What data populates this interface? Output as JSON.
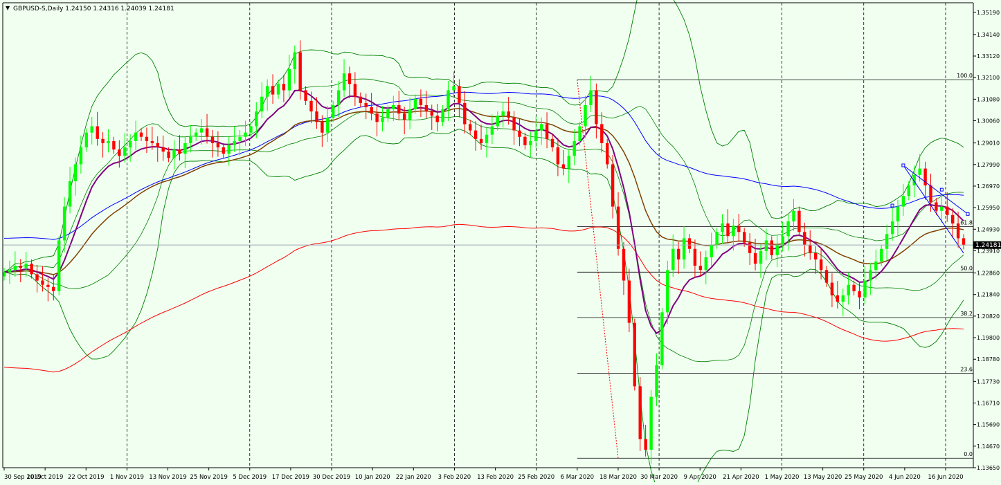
{
  "header": {
    "text": "GBPUSD-S,Daily  1.24150 1.24316 1.24039 1.24181",
    "menu_glyph": "▼"
  },
  "colors": {
    "background": "#f0fff0",
    "bull_candle": "#00ff00",
    "bear_candle": "#ff0000",
    "ma_purple": "#800080",
    "ma_brown": "#804000",
    "ma_blue": "#0000ff",
    "ma_red": "#ff0000",
    "bollinger": "#008000",
    "fib_level": "#000000",
    "trendline": "#0000ff"
  },
  "chart_data": {
    "type": "candlestick",
    "symbol": "GBPUSD-S",
    "timeframe": "Daily",
    "last_quote": {
      "open": 1.2415,
      "high": 1.24316,
      "low": 1.24039,
      "close": 1.24181
    },
    "current_price_label": "1.24181",
    "current_price": 1.24181,
    "ylim": [
      1.1365,
      1.3564
    ],
    "y_ticks": [
      "1.35190",
      "1.34140",
      "1.33120",
      "1.32100",
      "1.31080",
      "1.30060",
      "1.29010",
      "1.27990",
      "1.26970",
      "1.25950",
      "1.24930",
      "1.23910",
      "1.22860",
      "1.21840",
      "1.20820",
      "1.19800",
      "1.18780",
      "1.17730",
      "1.16710",
      "1.15690",
      "1.14670",
      "1.13650"
    ],
    "x_labels": [
      "30 Sep 2019",
      "10 Oct 2019",
      "22 Oct 2019",
      "1 Nov 2019",
      "13 Nov 2019",
      "25 Nov 2019",
      "5 Dec 2019",
      "17 Dec 2019",
      "30 Dec 2019",
      "10 Jan 2020",
      "22 Jan 2020",
      "3 Feb 2020",
      "13 Feb 2020",
      "25 Feb 2020",
      "6 Mar 2020",
      "18 Mar 2020",
      "30 Mar 2020",
      "9 Apr 2020",
      "21 Apr 2020",
      "1 May 2020",
      "13 May 2020",
      "25 May 2020",
      "4 Jun 2020",
      "16 Jun 2020"
    ],
    "period_separators": [
      "1 Nov 2019",
      "5 Dec 2019",
      "30 Dec 2019",
      "3 Feb 2020",
      "25 Feb 2020",
      "30 Mar 2020",
      "1 May 2020",
      "25 May 2020",
      "16 Jun 2020"
    ],
    "fibonacci": [
      {
        "label": "100.0",
        "price": 1.32
      },
      {
        "label": "61.8",
        "price": 1.2505
      },
      {
        "label": "50.0",
        "price": 1.229
      },
      {
        "label": "38.2",
        "price": 1.2075
      },
      {
        "label": "23.6",
        "price": 1.1812
      },
      {
        "label": "0.0",
        "price": 1.141
      }
    ],
    "closes": [
      1.229,
      1.23,
      1.232,
      1.231,
      1.233,
      1.228,
      1.225,
      1.223,
      1.222,
      1.22,
      1.244,
      1.26,
      1.272,
      1.28,
      1.288,
      1.295,
      1.298,
      1.292,
      1.29,
      1.291,
      1.287,
      1.284,
      1.288,
      1.291,
      1.295,
      1.293,
      1.291,
      1.29,
      1.288,
      1.286,
      1.283,
      1.287,
      1.285,
      1.29,
      1.293,
      1.295,
      1.297,
      1.293,
      1.29,
      1.288,
      1.285,
      1.289,
      1.291,
      1.293,
      1.295,
      1.298,
      1.305,
      1.312,
      1.317,
      1.313,
      1.318,
      1.315,
      1.325,
      1.333,
      1.315,
      1.31,
      1.305,
      1.3,
      1.295,
      1.302,
      1.308,
      1.315,
      1.323,
      1.318,
      1.312,
      1.309,
      1.307,
      1.304,
      1.3,
      1.302,
      1.306,
      1.308,
      1.304,
      1.301,
      1.306,
      1.311,
      1.308,
      1.305,
      1.303,
      1.3,
      1.306,
      1.315,
      1.317,
      1.309,
      1.299,
      1.296,
      1.292,
      1.29,
      1.294,
      1.298,
      1.303,
      1.305,
      1.302,
      1.296,
      1.293,
      1.289,
      1.291,
      1.296,
      1.299,
      1.292,
      1.288,
      1.28,
      1.278,
      1.284,
      1.291,
      1.298,
      1.308,
      1.315,
      1.299,
      1.29,
      1.28,
      1.26,
      1.24,
      1.225,
      1.205,
      1.175,
      1.15,
      1.145,
      1.17,
      1.185,
      1.21,
      1.23,
      1.24,
      1.235,
      1.245,
      1.24,
      1.232,
      1.23,
      1.236,
      1.242,
      1.248,
      1.252,
      1.246,
      1.251,
      1.248,
      1.243,
      1.238,
      1.233,
      1.239,
      1.244,
      1.237,
      1.242,
      1.246,
      1.253,
      1.258,
      1.248,
      1.242,
      1.238,
      1.235,
      1.23,
      1.224,
      1.218,
      1.215,
      1.218,
      1.223,
      1.22,
      1.217,
      1.225,
      1.23,
      1.234,
      1.24,
      1.247,
      1.253,
      1.26,
      1.265,
      1.27,
      1.275,
      1.278,
      1.27,
      1.262,
      1.258,
      1.26,
      1.256,
      1.252,
      1.245,
      1.2418
    ]
  }
}
